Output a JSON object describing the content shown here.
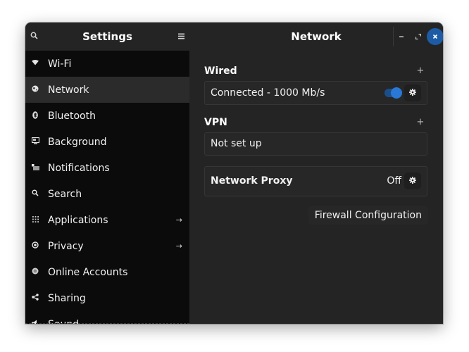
{
  "header": {
    "sidebar_title": "Settings",
    "panel_title": "Network",
    "search_icon": "search-icon",
    "menu_icon": "hamburger-menu-icon",
    "minimize_icon": "minimize-icon",
    "maximize_icon": "maximize-icon",
    "close_icon": "close-icon"
  },
  "sidebar": {
    "items": [
      {
        "label": "Wi-Fi",
        "icon": "wifi-icon",
        "active": false,
        "arrow": false
      },
      {
        "label": "Network",
        "icon": "network-globe-icon",
        "active": true,
        "arrow": false
      },
      {
        "label": "Bluetooth",
        "icon": "bluetooth-icon",
        "active": false,
        "arrow": false
      },
      {
        "label": "Background",
        "icon": "display-icon",
        "active": false,
        "arrow": false
      },
      {
        "label": "Notifications",
        "icon": "notifications-icon",
        "active": false,
        "arrow": false
      },
      {
        "label": "Search",
        "icon": "search-icon",
        "active": false,
        "arrow": false
      },
      {
        "label": "Applications",
        "icon": "grid-icon",
        "active": false,
        "arrow": true
      },
      {
        "label": "Privacy",
        "icon": "privacy-icon",
        "active": false,
        "arrow": true
      },
      {
        "label": "Online Accounts",
        "icon": "online-accounts-icon",
        "active": false,
        "arrow": false
      },
      {
        "label": "Sharing",
        "icon": "share-icon",
        "active": false,
        "arrow": false
      },
      {
        "label": "Sound",
        "icon": "speaker-icon",
        "active": false,
        "arrow": false
      }
    ]
  },
  "content": {
    "wired": {
      "title": "Wired",
      "status": "Connected - 1000 Mb/s",
      "toggle_on": true
    },
    "vpn": {
      "title": "VPN",
      "status": "Not set up"
    },
    "proxy": {
      "label": "Network Proxy",
      "value": "Off"
    },
    "firewall_button": "Firewall Configuration"
  },
  "colors": {
    "accent": "#2a78d6",
    "close_button": "#1d5ca5",
    "sidebar_bg": "#0b0b0b",
    "content_bg": "#242424"
  }
}
